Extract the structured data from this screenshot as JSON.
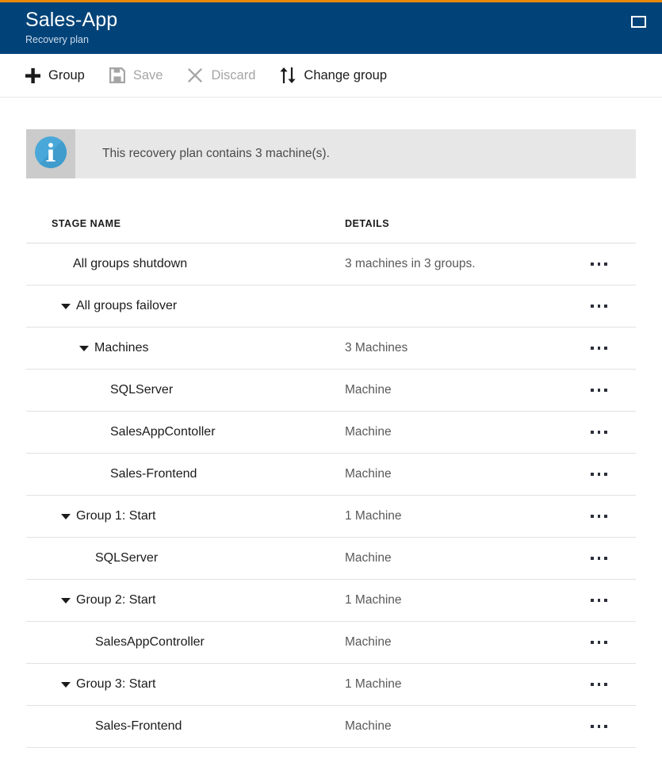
{
  "theme": {
    "accent_bar": "#e8890c",
    "header_bg": "#014378",
    "info_icon_blue": "#4aa8d8"
  },
  "header": {
    "title": "Sales-App",
    "subtitle": "Recovery plan",
    "window_button_icon": "maximize-restore-icon"
  },
  "toolbar": {
    "commands": [
      {
        "label": "Group",
        "icon": "plus-icon",
        "disabled": false
      },
      {
        "label": "Save",
        "icon": "save-floppy-icon",
        "disabled": true
      },
      {
        "label": "Discard",
        "icon": "close-x-icon",
        "disabled": true
      },
      {
        "label": "Change group",
        "icon": "sort-arrows-icon",
        "disabled": false
      }
    ]
  },
  "info_banner": {
    "icon": "info-circle-icon",
    "message": "This recovery plan contains 3 machine(s)."
  },
  "table": {
    "columns": {
      "stage_name": "STAGE NAME",
      "details": "DETAILS"
    },
    "row_menu_icon": "ellipsis-menu-icon",
    "rows": [
      {
        "name": "All groups shutdown",
        "details": "3 machines in 3 groups.",
        "indent": 0,
        "caret": "none",
        "menu": true
      },
      {
        "name": "All groups failover",
        "details": "",
        "indent": 0,
        "caret": "expanded",
        "menu": true
      },
      {
        "name": "Machines",
        "details": "3 Machines",
        "indent": 1,
        "caret": "expanded",
        "menu": true
      },
      {
        "name": "SQLServer",
        "details": "Machine",
        "indent": 2,
        "caret": "none",
        "menu": true
      },
      {
        "name": "SalesAppContoller",
        "details": "Machine",
        "indent": 2,
        "caret": "none",
        "menu": true
      },
      {
        "name": "Sales-Frontend",
        "details": "Machine",
        "indent": 2,
        "caret": "none",
        "menu": true
      },
      {
        "name": "Group 1: Start",
        "details": "1 Machine",
        "indent": 0,
        "caret": "expanded",
        "menu": true
      },
      {
        "name": "SQLServer",
        "details": "Machine",
        "indent": 1,
        "caret": "none",
        "menu": true
      },
      {
        "name": "Group 2: Start",
        "details": "1 Machine",
        "indent": 0,
        "caret": "expanded",
        "menu": true
      },
      {
        "name": "SalesAppController",
        "details": "Machine",
        "indent": 1,
        "caret": "none",
        "menu": true
      },
      {
        "name": "Group 3: Start",
        "details": "1 Machine",
        "indent": 0,
        "caret": "expanded",
        "menu": true
      },
      {
        "name": "Sales-Frontend",
        "details": "Machine",
        "indent": 1,
        "caret": "none",
        "menu": true
      }
    ]
  }
}
